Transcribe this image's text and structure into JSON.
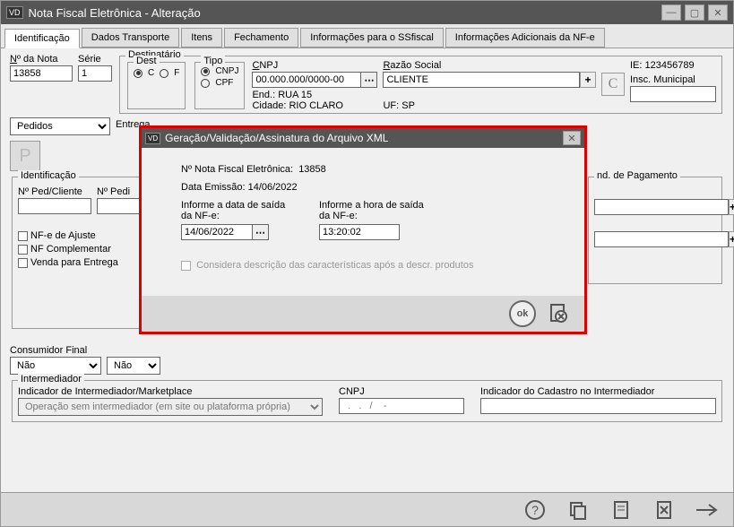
{
  "window": {
    "title": "Nota Fiscal Eletrônica - Alteração"
  },
  "tabs": [
    {
      "label": "Identificação",
      "accel": "I",
      "active": true
    },
    {
      "label": "Dados Transporte",
      "accel": "D",
      "active": false
    },
    {
      "label": "Itens",
      "accel": "t",
      "active": false
    },
    {
      "label": "Fechamento",
      "accel": "F",
      "active": false
    },
    {
      "label": "Informações para o SSfiscal",
      "accel": "S",
      "active": false
    },
    {
      "label": "Informações Adicionais da NF-e",
      "accel": "A",
      "active": false
    }
  ],
  "nota": {
    "n_label": "Nº da Nota",
    "n_value": "13858",
    "serie_label": "Série",
    "serie_value": "1",
    "pedidos": "Pedidos"
  },
  "dest": {
    "legend": "Destinatário",
    "dest_label": "Dest",
    "c": "C",
    "f": "F",
    "entrega_label": "Entrega",
    "tipo_label": "Tipo",
    "cnpj_radio": "CNPJ",
    "cpf_radio": "CPF",
    "cnpj_label": "CNPJ",
    "cnpj_value": "00.000.000/0000-00",
    "razao_label": "Razão Social",
    "razao_value": "CLIENTE",
    "end_label": "End.:",
    "end_value": "RUA 15",
    "cidade_label": "Cidade:",
    "cidade_value": "RIO CLARO",
    "uf_label": "UF:",
    "uf_value": "SP",
    "ie_label": "IE:",
    "ie_value": "123456789",
    "insc_label": "Insc. Municipal"
  },
  "ident": {
    "legend": "Identificação",
    "ped_cli": "Nº Ped/Cliente",
    "ped": "Nº Pedi",
    "nfe_ajuste": "NF-e de Ajuste",
    "nf_compl": "NF Complementar",
    "venda_entrega": "Venda para Entrega"
  },
  "cond_pag": {
    "legend": "nd. de Pagamento"
  },
  "consumidor": {
    "label": "Consumidor Final",
    "value": "Não",
    "nao2": "Não"
  },
  "intermed": {
    "legend": "Intermediador",
    "ind_label": "Indicador de Intermediador/Marketplace",
    "ind_value": "Operação sem intermediador (em site ou plataforma própria)",
    "cnpj_label": "CNPJ",
    "cnpj_value": "  .   .   /    -",
    "cad_label": "Indicador do Cadastro no Intermediador"
  },
  "modal": {
    "title": "Geração/Validação/Assinatura do Arquivo XML",
    "l1_label": "Nº Nota Fiscal Eletrônica:",
    "l1_value": "13858",
    "l2_label": "Data Emissão:",
    "l2_value": "14/06/2022",
    "data_label": "Informe a data de saída da NF-e:",
    "data_value": "14/06/2022",
    "hora_label": "Informe a hora de saída da NF-e:",
    "hora_value": "13:20:02",
    "chk_label": "Considera descrição das características após a descr. produtos",
    "ok": "ok"
  }
}
